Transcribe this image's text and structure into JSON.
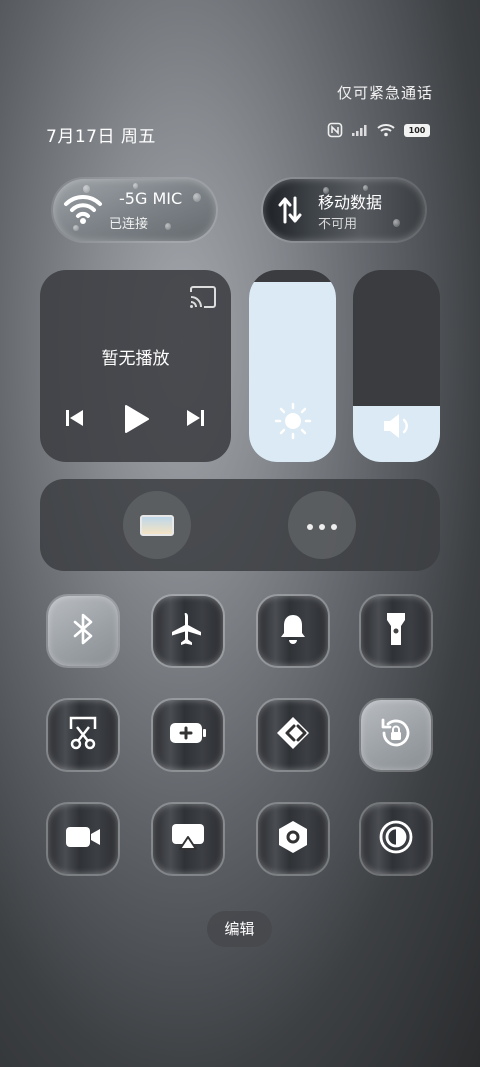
{
  "status": {
    "emergency": "仅可紧急通话",
    "date": "7月17日 周五",
    "battery": "100"
  },
  "wifi": {
    "title": "-5G   MIC",
    "subtitle": "已连接"
  },
  "mobile": {
    "title": "移动数据",
    "subtitle": "不可用"
  },
  "media": {
    "title": "暂无播放"
  },
  "brightness": {
    "level": 0.94
  },
  "volume": {
    "level": 0.29
  },
  "footer": {
    "edit": "编辑"
  },
  "tiles": [
    {
      "icon": "bluetooth-icon",
      "on": true
    },
    {
      "icon": "airplane-icon",
      "on": false
    },
    {
      "icon": "bell-icon",
      "on": false
    },
    {
      "icon": "flashlight-icon",
      "on": false
    },
    {
      "icon": "screenshot-icon",
      "on": false
    },
    {
      "icon": "battery-saver-icon",
      "on": false
    },
    {
      "icon": "nearby-share-icon",
      "on": false
    },
    {
      "icon": "rotation-lock-icon",
      "on": true
    },
    {
      "icon": "screen-record-icon",
      "on": false
    },
    {
      "icon": "screen-cast-icon",
      "on": false
    },
    {
      "icon": "settings-hex-icon",
      "on": false
    },
    {
      "icon": "dark-mode-icon",
      "on": false
    }
  ]
}
